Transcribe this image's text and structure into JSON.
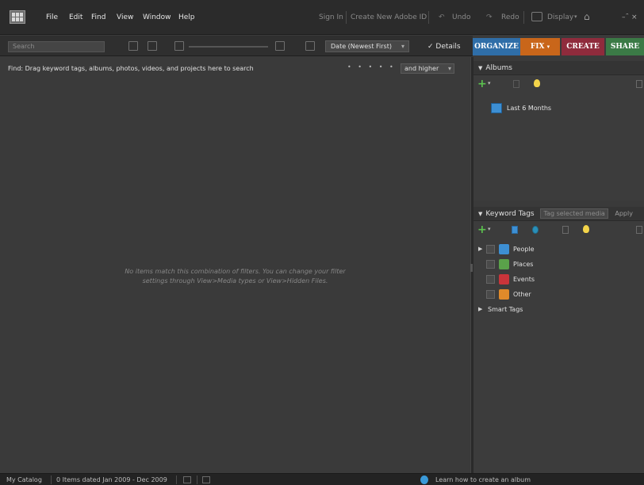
{
  "menubar": {
    "items": [
      "File",
      "Edit",
      "Find",
      "View",
      "Window",
      "Help"
    ],
    "sign_in": "Sign In",
    "create_id": "Create New Adobe ID",
    "undo": "Undo",
    "redo": "Redo",
    "display": "Display",
    "zoom_label": "–  ̑ ×"
  },
  "toolbar": {
    "search_placeholder": "Search",
    "sort_value": "Date (Newest First)",
    "details_label": "Details",
    "details_checked": true
  },
  "tabs": {
    "organize": "ORGANIZE",
    "fix": "FIX",
    "create": "CREATE",
    "share": "SHARE"
  },
  "findbar": {
    "text": "Find: Drag keyword tags, albums, photos, videos, and projects here to search",
    "stars": "• • • • •",
    "rating_value": "and higher"
  },
  "media": {
    "empty_line1": "No items match this combination of filters. You can change your filter",
    "empty_line2": "settings through View>Media types or View>Hidden Files."
  },
  "albums": {
    "header": "Albums",
    "items": [
      {
        "label": "Last 6 Months"
      }
    ]
  },
  "keyword_tags": {
    "header": "Keyword Tags",
    "input_placeholder": "Tag selected media",
    "apply_label": "Apply",
    "items": [
      {
        "label": "People",
        "color": "#3d8fd3"
      },
      {
        "label": "Places",
        "color": "#5aa24a"
      },
      {
        "label": "Events",
        "color": "#c8343a"
      },
      {
        "label": "Other",
        "color": "#e08a2a"
      }
    ],
    "smart_tags": "Smart Tags"
  },
  "statusbar": {
    "catalog": "My Catalog",
    "items_info": "0 Items dated Jan 2009 - Dec 2009",
    "help_link": "Learn how to create an album"
  }
}
